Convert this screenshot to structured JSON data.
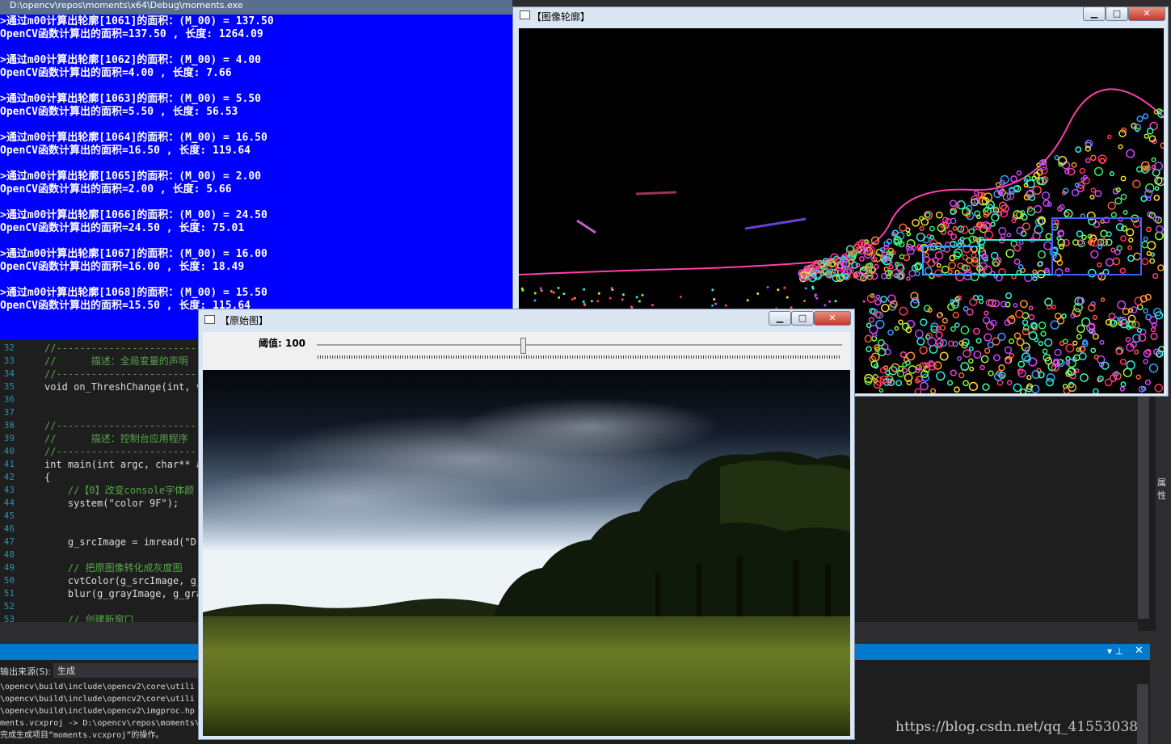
{
  "console": {
    "title": "D:\\opencv\\repos\\moments\\x64\\Debug\\moments.exe",
    "lines": [
      ">通过m00计算出轮廓[1061]的面积：(M_00) = 137.50",
      "OpenCV函数计算出的面积=137.50 , 长度: 1264.09",
      "",
      ">通过m00计算出轮廓[1062]的面积：(M_00) = 4.00",
      "OpenCV函数计算出的面积=4.00 , 长度: 7.66",
      "",
      ">通过m00计算出轮廓[1063]的面积：(M_00) = 5.50",
      "OpenCV函数计算出的面积=5.50 , 长度: 56.53",
      "",
      ">通过m00计算出轮廓[1064]的面积：(M_00) = 16.50",
      "OpenCV函数计算出的面积=16.50 , 长度: 119.64",
      "",
      ">通过m00计算出轮廓[1065]的面积：(M_00) = 2.00",
      "OpenCV函数计算出的面积=2.00 , 长度: 5.66",
      "",
      ">通过m00计算出轮廓[1066]的面积：(M_00) = 24.50",
      "OpenCV函数计算出的面积=24.50 , 长度: 75.01",
      "",
      ">通过m00计算出轮廓[1067]的面积：(M_00) = 16.00",
      "OpenCV函数计算出的面积=16.00 , 长度: 18.49",
      "",
      ">通过m00计算出轮廓[1068]的面积：(M_00) = 15.50",
      "OpenCV函数计算出的面积=15.50 , 长度: 115.64"
    ]
  },
  "contour_window": {
    "title": "【图像轮廓】",
    "minimize": "▁",
    "maximize": "□",
    "close": "✕"
  },
  "original_window": {
    "title": "【原始图】",
    "minimize": "▁",
    "maximize": "□",
    "close": "✕",
    "slider_label": "阈值: 100",
    "threshold": 100,
    "threshold_max": 255
  },
  "editor": {
    "lines": [
      {
        "n": "32",
        "text": "//-------------------------",
        "cls": "c-com"
      },
      {
        "n": "33",
        "text": "//      描述：全局变量的声明",
        "cls": "c-com"
      },
      {
        "n": "34",
        "text": "//-------------------------",
        "cls": "c-com"
      },
      {
        "n": "35",
        "text": "void on_ThreshChange(int, v",
        "cls": ""
      },
      {
        "n": "36",
        "text": "",
        "cls": ""
      },
      {
        "n": "37",
        "text": "",
        "cls": ""
      },
      {
        "n": "38",
        "text": "//-------------------------",
        "cls": "c-com"
      },
      {
        "n": "39",
        "text": "//      描述：控制台应用程序",
        "cls": "c-com"
      },
      {
        "n": "40",
        "text": "//-------------------------",
        "cls": "c-com"
      },
      {
        "n": "41",
        "text": "int main(int argc, char** a",
        "cls": ""
      },
      {
        "n": "42",
        "text": "{",
        "cls": ""
      },
      {
        "n": "43",
        "text": "    //【0】改变console字体颜",
        "cls": "c-com"
      },
      {
        "n": "44",
        "text": "    system(\"color 9F\");",
        "cls": ""
      },
      {
        "n": "45",
        "text": "",
        "cls": ""
      },
      {
        "n": "46",
        "text": "",
        "cls": ""
      },
      {
        "n": "47",
        "text": "    g_srcImage = imread(\"D:",
        "cls": ""
      },
      {
        "n": "48",
        "text": "",
        "cls": ""
      },
      {
        "n": "49",
        "text": "    // 把原图像转化成灰度图",
        "cls": "c-com"
      },
      {
        "n": "50",
        "text": "    cvtColor(g_srcImage, g_",
        "cls": ""
      },
      {
        "n": "51",
        "text": "    blur(g_grayImage, g_gra",
        "cls": ""
      },
      {
        "n": "52",
        "text": "",
        "cls": ""
      },
      {
        "n": "53",
        "text": "    // 创建新窗口",
        "cls": "c-com"
      }
    ]
  },
  "output": {
    "source_label": "输出来源(S):",
    "source_value": "生成",
    "lines": [
      "\\opencv\\build\\include\\opencv2\\core\\utili",
      "\\opencv\\build\\include\\opencv2\\core\\utili",
      "\\opencv\\build\\include\\opencv2\\imgproc.hp",
      "ments.vcxproj -> D:\\opencv\\repos\\moments\\",
      "完成生成项目“moments.vcxproj”的操作。"
    ]
  },
  "side_panel_label": "属性",
  "watermark": "https://blog.csdn.net/qq_41553038",
  "colors": {
    "console_bg": "#0000ff",
    "console_text": "#ffffff",
    "ide_bg": "#1e1e1e",
    "output_bar": "#007acc"
  }
}
